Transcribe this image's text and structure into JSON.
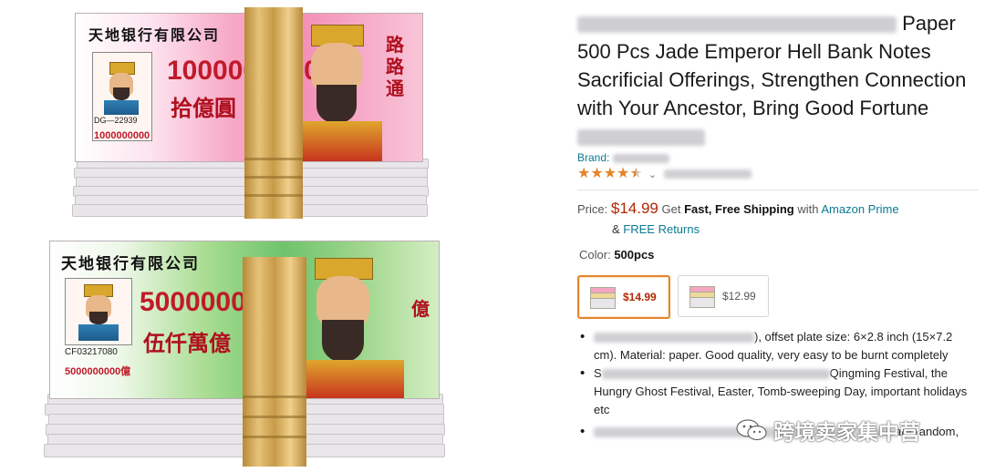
{
  "product_image": {
    "top_note": {
      "bank_name": "天地银行有限公司",
      "amount": "1000000000",
      "amount_chinese": "拾億圓",
      "serial": "DG—22939",
      "serial_amount": "1000000000",
      "side_text": "路路通"
    },
    "bottom_note": {
      "bank_name": "天地银行有限公司",
      "amount": "5000000000",
      "amount_chinese": "伍仟萬億",
      "serial": "CF03217080",
      "serial_amount": "5000000000億",
      "side_text": "億"
    }
  },
  "product": {
    "title_line1_tail": "Paper",
    "title_rest": "500 Pcs Jade Emperor Hell Bank Notes Sacrificial Offerings, Strengthen Connection with Your Ancestor, Bring Good Fortune",
    "brand_label": "Brand:",
    "rating_stars": 4.5,
    "rating_chevron": "⌄",
    "price_label": "Price:",
    "price": "$14.99",
    "shipping_pre": "Get",
    "shipping_bold": "Fast, Free Shipping",
    "shipping_mid": "with",
    "shipping_link": "Amazon Prime",
    "returns_prefix": "&",
    "returns_link": "FREE Returns",
    "color_label": "Color:",
    "color_value": "500pcs",
    "swatches": [
      {
        "price": "$14.99",
        "selected": true
      },
      {
        "price": "$12.99",
        "selected": false
      }
    ],
    "bullets": [
      {
        "visible": "), offset plate size: 6×2.8 inch (15×7.2 cm). Material: paper. Good quality, very easy to be burnt completely"
      },
      {
        "prefix": "S",
        "visible": "Qingming Festival, the Hungry Ghost Festival, Easter, Tomb-sweeping Day, important holidays etc"
      },
      {
        "visible": "are random,"
      }
    ]
  },
  "watermark": {
    "text": "跨境卖家集中营"
  },
  "colors": {
    "price": "#b12704",
    "link": "#0a7a93",
    "star": "#e4852a",
    "selected_border": "#e4852a"
  }
}
